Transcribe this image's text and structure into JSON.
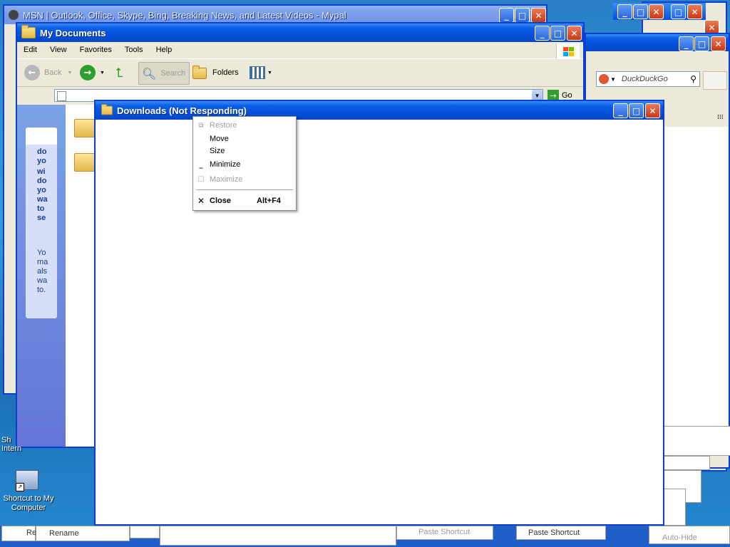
{
  "browser_window": {
    "title": "MSN | Outlook, Office, Skype, Bing, Breaking News, and Latest Videos - Mypal",
    "search_placeholder": "DuckDuckGo"
  },
  "my_documents": {
    "title": "My Documents",
    "menu": [
      "Edit",
      "View",
      "Favorites",
      "Tools",
      "Help"
    ],
    "toolbar": {
      "back": "Back",
      "search": "Search",
      "folders": "Folders"
    },
    "go_label": "Go",
    "side_panel_text_1": "do yo",
    "side_panel_text_2": "wi do yo wa to se",
    "side_panel_text_3": "Yo ma als wa to."
  },
  "downloads": {
    "title": "Downloads (Not Responding)"
  },
  "system_menu": {
    "items": [
      {
        "label": "Restore",
        "icon": "restore-icon",
        "enabled": false,
        "accelerator": ""
      },
      {
        "label": "Move",
        "icon": "",
        "enabled": true,
        "accelerator": ""
      },
      {
        "label": "Size",
        "icon": "",
        "enabled": true,
        "accelerator": ""
      },
      {
        "label": "Minimize",
        "icon": "minimize-icon",
        "enabled": true,
        "accelerator": ""
      },
      {
        "label": "Maximize",
        "icon": "maximize-icon",
        "enabled": false,
        "accelerator": ""
      },
      {
        "label": "Close",
        "icon": "close-icon",
        "enabled": true,
        "accelerator": "Alt+F4",
        "bold": true
      }
    ]
  },
  "desktop": {
    "shortcut_computer": "Shortcut to My Computer",
    "shortcut_ie_partial": "Sh Intern"
  },
  "bottom_fragments": {
    "rename": "Rename",
    "re": "Re",
    "paste_shortcut": "Paste Shortcut",
    "paste_shortcut_faded": "Paste Shortcut",
    "auto_hide": "Auto-Hide"
  },
  "colors": {
    "title_active": "#0551da",
    "title_close": "#c83a16",
    "desktop_blue": "#2a7fc7"
  }
}
